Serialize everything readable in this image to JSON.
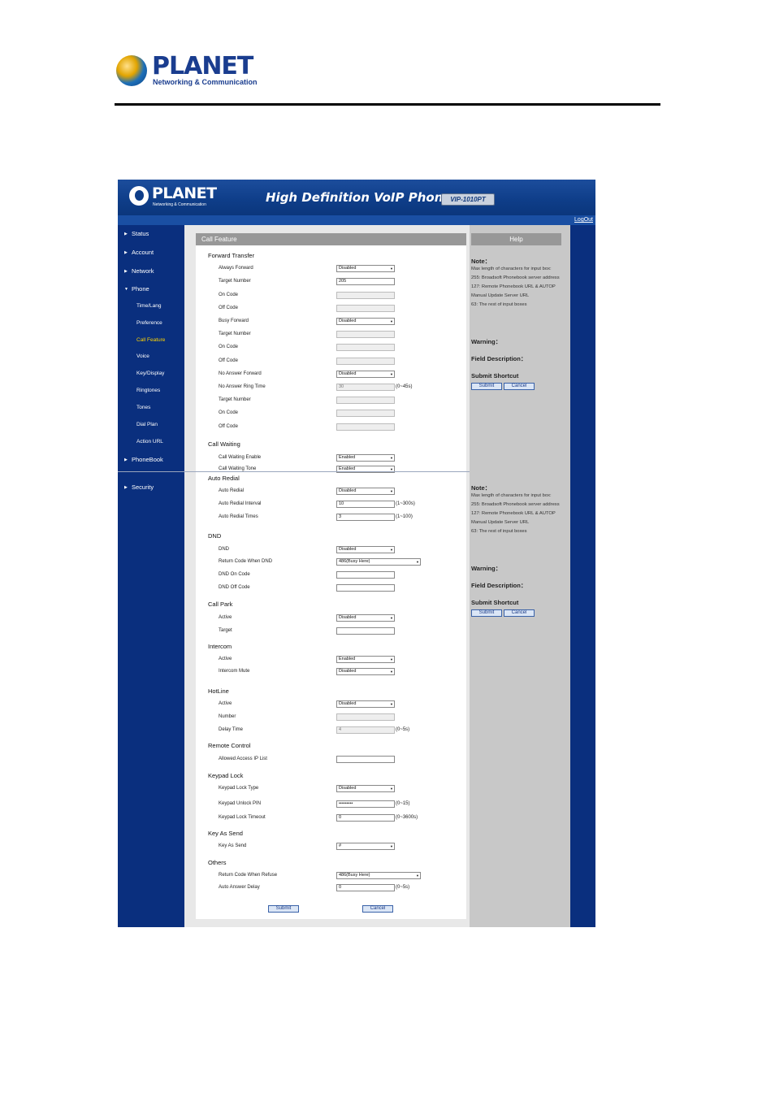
{
  "doc_header": {
    "brand": "PLANET",
    "tagline": "Networking & Communication"
  },
  "banner": {
    "brand": "PLANET",
    "tagline": "Networking & Communication",
    "title": "High Definition VoIP Phone",
    "model": "VIP-1010PT",
    "logout": "LogOut"
  },
  "sidebar": {
    "items": [
      {
        "label": "Status"
      },
      {
        "label": "Account"
      },
      {
        "label": "Network"
      },
      {
        "label": "Phone",
        "expanded": true
      },
      {
        "label": "PhoneBook"
      },
      {
        "label": "Security"
      }
    ],
    "phone_sub": [
      {
        "label": "Time/Lang"
      },
      {
        "label": "Preference"
      },
      {
        "label": "Call Feature",
        "active": true
      },
      {
        "label": "Voice"
      },
      {
        "label": "Key/Display"
      },
      {
        "label": "Ringtones"
      },
      {
        "label": "Tones"
      },
      {
        "label": "Dial Plan"
      },
      {
        "label": "Action URL"
      }
    ],
    "active_color": "#ffd400"
  },
  "main": {
    "title": "Call Feature",
    "forward_transfer": {
      "heading": "Forward Transfer",
      "always_forward": {
        "label": "Always Forward",
        "value": "Disabled"
      },
      "target_number_1": {
        "label": "Target Number",
        "value": "205"
      },
      "on_code_1": {
        "label": "On Code",
        "value": ""
      },
      "off_code_1": {
        "label": "Off Code",
        "value": ""
      },
      "busy_forward": {
        "label": "Busy Forward",
        "value": "Disabled"
      },
      "target_number_2": {
        "label": "Target Number",
        "value": ""
      },
      "on_code_2": {
        "label": "On Code",
        "value": ""
      },
      "off_code_2": {
        "label": "Off Code",
        "value": ""
      },
      "no_answer_forward": {
        "label": "No Answer Forward",
        "value": "Disabled"
      },
      "no_answer_ring_time": {
        "label": "No Answer Ring Time",
        "value": "30",
        "range": "(0~45s)"
      },
      "target_number_3": {
        "label": "Target Number",
        "value": ""
      },
      "on_code_3": {
        "label": "On Code",
        "value": ""
      },
      "off_code_3": {
        "label": "Off Code",
        "value": ""
      }
    },
    "call_waiting": {
      "heading": "Call Waiting",
      "enable": {
        "label": "Call Waiting Enable",
        "value": "Enabled"
      },
      "tone": {
        "label": "Call Waiting Tone",
        "value": "Enabled"
      }
    },
    "auto_redial": {
      "heading": "Auto Redial",
      "auto_redial": {
        "label": "Auto Redial",
        "value": "Disabled"
      },
      "interval": {
        "label": "Auto Redial Interval",
        "value": "10",
        "range": "(1~300s)"
      },
      "times": {
        "label": "Auto Redial Times",
        "value": "3",
        "range": "(1~100)"
      }
    },
    "dnd": {
      "heading": "DND",
      "dnd": {
        "label": "DND",
        "value": "Disabled"
      },
      "return_code": {
        "label": "Return Code When DND",
        "value": "486(Busy Here)"
      },
      "on_code": {
        "label": "DND On Code",
        "value": ""
      },
      "off_code": {
        "label": "DND Off Code",
        "value": ""
      }
    },
    "call_park": {
      "heading": "Call Park",
      "active": {
        "label": "Active",
        "value": "Disabled"
      },
      "target": {
        "label": "Target",
        "value": ""
      }
    },
    "intercom": {
      "heading": "Intercom",
      "active": {
        "label": "Active",
        "value": "Enabled"
      },
      "mute": {
        "label": "Intercom Mute",
        "value": "Disabled"
      }
    },
    "hotline": {
      "heading": "HotLine",
      "active": {
        "label": "Active",
        "value": "Disabled"
      },
      "number": {
        "label": "Number",
        "value": ""
      },
      "delay": {
        "label": "Delay Time",
        "value": "4",
        "range": "(0~5s)"
      }
    },
    "remote_control": {
      "heading": "Remote Control",
      "allowed_ip": {
        "label": "Allowed Access IP List",
        "value": ""
      }
    },
    "keypad_lock": {
      "heading": "Keypad Lock",
      "type": {
        "label": "Keypad Lock Type",
        "value": "Disabled"
      },
      "pin": {
        "label": "Keypad Unlock PIN",
        "value": "•••••••••",
        "range": "(0~15)"
      },
      "timeout": {
        "label": "Keypad Lock Timeout",
        "value": "0",
        "range": "(0~3600s)"
      }
    },
    "key_as_send": {
      "heading": "Key As Send",
      "key": {
        "label": "Key As Send",
        "value": "#"
      }
    },
    "others": {
      "heading": "Others",
      "return_code_refuse": {
        "label": "Return Code When Refuse",
        "value": "486(Busy Here)"
      },
      "auto_answer_delay": {
        "label": "Auto Answer Delay",
        "value": "0",
        "range": "(0~5s)"
      }
    },
    "submit_label": "Submit",
    "cancel_label": "Cancel"
  },
  "help": {
    "title": "Help",
    "note_heading": "Note：",
    "note_lines": [
      "Max length of characters for input box:",
      "255: Broadsoft Phonebook server address",
      "127: Remote Phonebook URL & AUTOP Manual Update Server URL",
      "63: The rest of input boxes"
    ],
    "warning_heading": "Warning：",
    "field_heading": "Field Description：",
    "shortcut_heading": "Submit Shortcut",
    "submit_label": "Submit",
    "cancel_label": "Cancel"
  }
}
